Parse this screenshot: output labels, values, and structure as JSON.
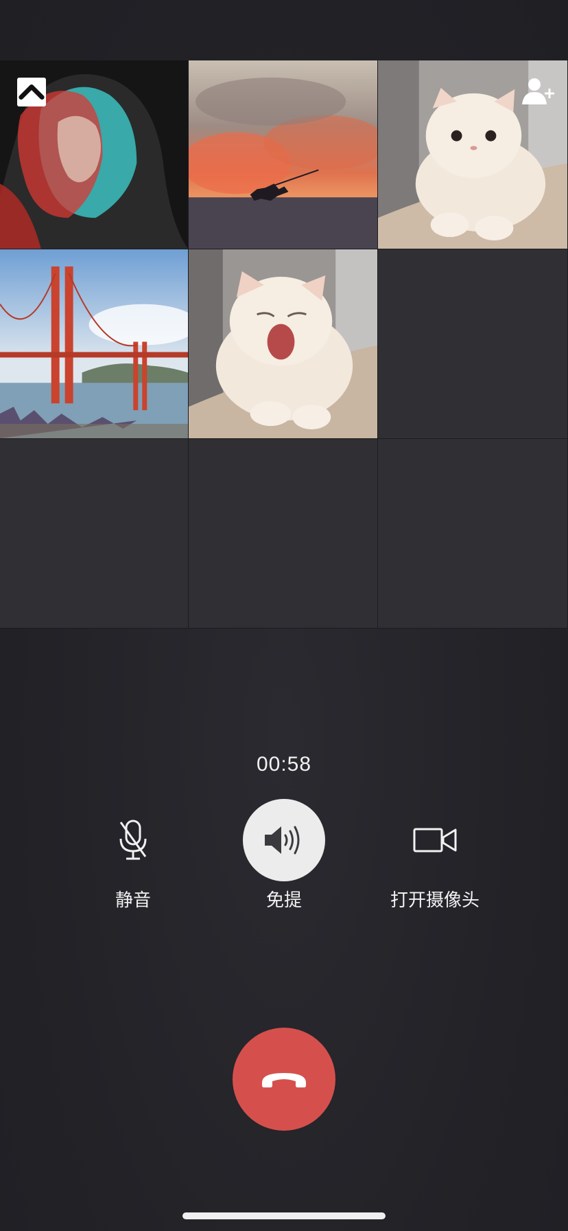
{
  "grid": {
    "collapse_icon": "chevron-up-icon",
    "add_member_icon": "add-person-icon",
    "tiles": [
      {
        "kind": "avatar",
        "subject": "portrait"
      },
      {
        "kind": "avatar",
        "subject": "sunset-rider"
      },
      {
        "kind": "avatar",
        "subject": "cat"
      },
      {
        "kind": "avatar",
        "subject": "bridge"
      },
      {
        "kind": "avatar",
        "subject": "yawning-cat"
      },
      {
        "kind": "empty"
      },
      {
        "kind": "empty"
      },
      {
        "kind": "empty"
      },
      {
        "kind": "empty"
      }
    ]
  },
  "call": {
    "timer": "00:58",
    "controls": {
      "mute": {
        "label": "静音",
        "icon": "microphone-off-icon",
        "active": false
      },
      "speaker": {
        "label": "免提",
        "icon": "speaker-icon",
        "active": true
      },
      "camera": {
        "label": "打开摄像头",
        "icon": "video-camera-icon",
        "active": false
      }
    },
    "hangup_icon": "hang-up-icon"
  },
  "colors": {
    "background": "#26262b",
    "hangup": "#d5504c",
    "speaker_active": "#ececec",
    "text": "#f2f2f2"
  }
}
